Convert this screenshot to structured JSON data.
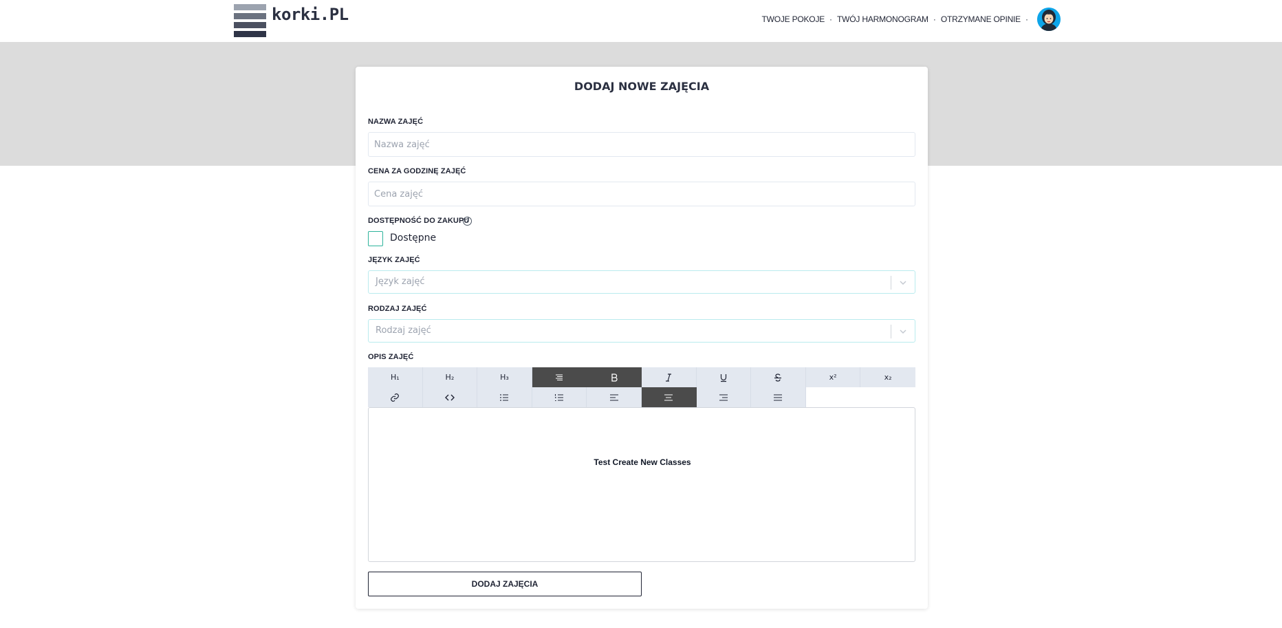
{
  "brand": {
    "logo_text": "korki.PL",
    "logo_bar_colors": [
      "#9ca3af",
      "#6b7280",
      "#4b5060",
      "#2f3447"
    ]
  },
  "nav": {
    "links": [
      "TWOJE POKOJE",
      "TWÓJ HARMONOGRAM",
      "OTRZYMANE OPINIE"
    ],
    "separator": "·"
  },
  "form": {
    "title": "DODAJ NOWE ZAJĘCIA",
    "name": {
      "label": "NAZWA ZAJĘĆ",
      "placeholder": "Nazwa zajęć",
      "value": ""
    },
    "price": {
      "label": "CENA ZA GODZINĘ ZAJĘĆ",
      "placeholder": "Cena zajęć",
      "value": ""
    },
    "availability": {
      "label": "DOSTĘPNOŚĆ DO ZAKUPU",
      "help": "?",
      "checkbox_label": "Dostępne",
      "checked": false
    },
    "language": {
      "label": "JĘZYK ZAJĘĆ",
      "placeholder": "Język zajęć"
    },
    "type": {
      "label": "RODZAJ ZAJĘĆ",
      "placeholder": "Rodzaj zajęć"
    },
    "description": {
      "label": "OPIS ZAJĘĆ",
      "content": "Test Create New Classes"
    },
    "submit_label": "DODAJ ZAJĘCIA"
  },
  "editor_toolbar": {
    "row1": [
      {
        "icon": "heading-1-icon",
        "text": "H₁",
        "active": false
      },
      {
        "icon": "heading-2-icon",
        "text": "H₂",
        "active": false
      },
      {
        "icon": "heading-3-icon",
        "text": "H₃",
        "active": false
      },
      {
        "icon": "paragraph-icon",
        "text": "",
        "active": true
      },
      {
        "icon": "bold-icon",
        "text": "",
        "active": true
      },
      {
        "icon": "italic-icon",
        "text": "",
        "active": false
      },
      {
        "icon": "underline-icon",
        "text": "",
        "active": false
      },
      {
        "icon": "strikethrough-icon",
        "text": "",
        "active": false
      },
      {
        "icon": "superscript-icon",
        "text": "x²",
        "active": false
      },
      {
        "icon": "subscript-icon",
        "text": "x₂",
        "active": false
      }
    ],
    "row2": [
      {
        "icon": "link-icon",
        "text": "",
        "active": false
      },
      {
        "icon": "code-icon",
        "text": "",
        "active": false
      },
      {
        "icon": "bullet-list-icon",
        "text": "",
        "active": false
      },
      {
        "icon": "ordered-list-icon",
        "text": "",
        "active": false
      },
      {
        "icon": "align-left-icon",
        "text": "",
        "active": false
      },
      {
        "icon": "align-center-icon",
        "text": "",
        "active": true
      },
      {
        "icon": "align-right-icon",
        "text": "",
        "active": false
      },
      {
        "icon": "align-justify-icon",
        "text": "",
        "active": false
      }
    ]
  },
  "colors": {
    "band": "#dcdcdc",
    "checkbox_border": "#2db39b",
    "select_border": "#b9ebee",
    "toolbar_bg": "#e3e8f0",
    "toolbar_active": "#4b4b4b"
  }
}
